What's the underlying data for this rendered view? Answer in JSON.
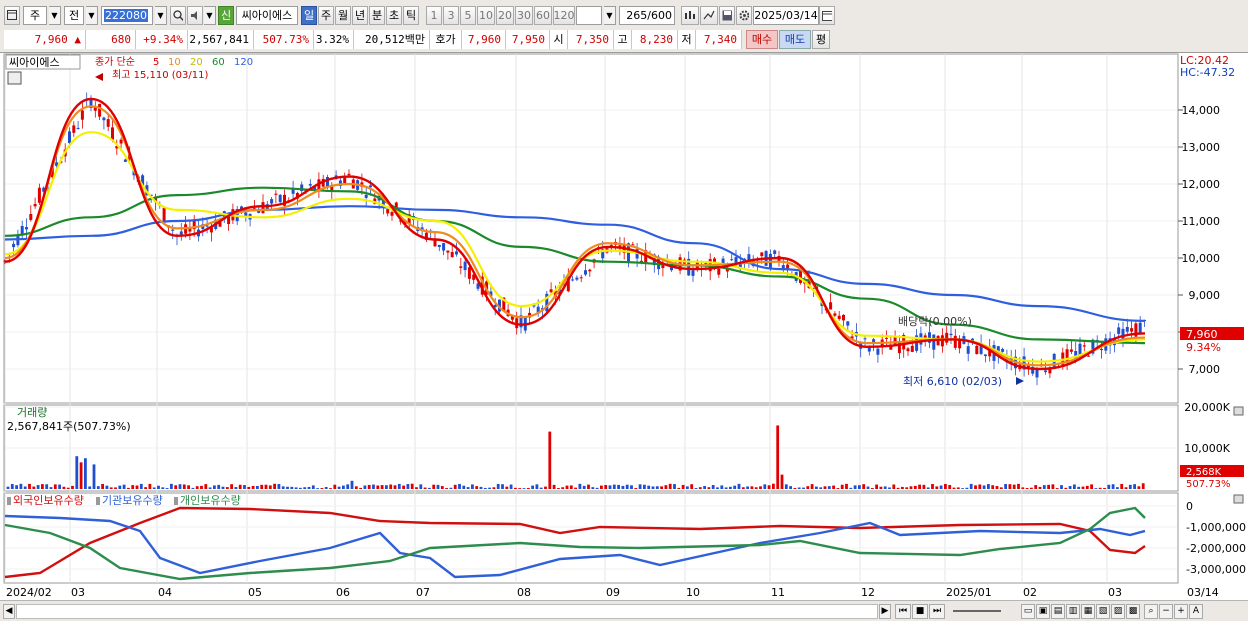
{
  "toolbar": {
    "type_label": "주",
    "prev_label": "전",
    "code": "222080",
    "badge_new": "신",
    "stock_name": "씨아이에스",
    "periods": [
      "일",
      "주",
      "월",
      "년",
      "분",
      "초",
      "틱"
    ],
    "active_period": "일",
    "intervals": [
      "1",
      "3",
      "5",
      "10",
      "20",
      "30",
      "60",
      "120"
    ],
    "count": "265",
    "count_total": "/600",
    "date": "2025/03/14"
  },
  "quote": {
    "price": "7,960",
    "arrow": "▲",
    "change": "680",
    "change_pct": "+9.34%",
    "volume": "2,567,841",
    "volume_pct": "507.73%",
    "turnover_pct": "3.32%",
    "amount": "20,512백만",
    "ask_label": "호가",
    "ask": "7,960",
    "bid": "7,950",
    "open_label": "시",
    "open": "7,350",
    "high_label": "고",
    "high": "8,230",
    "low_label": "저",
    "low": "7,340",
    "buy_label": "매수",
    "sell_label": "매도",
    "avg_label": "평"
  },
  "price_panel": {
    "name": "씨아이에스",
    "ma_label": "종가 단순",
    "ma_periods": [
      "5",
      "10",
      "20",
      "60",
      "120"
    ],
    "high_note": "최고 15,110 (03/11)",
    "low_note": "최저 6,610 (02/03)",
    "dividend_note": "배당락(0.00%)",
    "lc": "LC:20.42",
    "hc": "HC:-47.32",
    "y_ticks": [
      "14,000",
      "13,000",
      "12,000",
      "11,000",
      "10,000",
      "9,000",
      "8,000",
      "7,000"
    ],
    "last_price": "7,960",
    "last_pct": "9.34%"
  },
  "volume_panel": {
    "title": "거래량",
    "value": "2,567,841주(507.73%)",
    "y_ticks": [
      "20,000K",
      "10,000K"
    ],
    "last_value": "2,568K",
    "last_pct": "507.73%"
  },
  "holding_panel": {
    "legend": [
      "외국인보유수량",
      "기관보유수량",
      "개인보유수량"
    ],
    "y_ticks": [
      "0",
      "-1,000,000",
      "-2,000,000",
      "-3,000,000"
    ]
  },
  "x_axis": [
    "2024/02",
    "03",
    "04",
    "05",
    "06",
    "07",
    "08",
    "09",
    "10",
    "11",
    "12",
    "2025/01",
    "02",
    "03",
    "03/14"
  ],
  "colors": {
    "ma5": "#e00000",
    "ma10": "#f08a1c",
    "ma20": "#f4f000",
    "ma60": "#1a8a2a",
    "ma120": "#2f5fe0",
    "up": "#e00000",
    "down": "#1f4fd0",
    "foreign": "#d01010",
    "institution": "#3060d8",
    "individual": "#2d8c4e"
  },
  "chart_data": {
    "type": "line",
    "title": "씨아이에스",
    "x": [
      "2024/02",
      "03",
      "04",
      "05",
      "06",
      "07",
      "08",
      "09",
      "10",
      "11",
      "12",
      "2025/01",
      "02",
      "03"
    ],
    "series": [
      {
        "name": "5",
        "values": [
          9900,
          14300,
          10600,
          11400,
          12200,
          10500,
          8200,
          10300,
          9700,
          10000,
          7600,
          7800,
          7000,
          7960
        ]
      },
      {
        "name": "10",
        "values": [
          10000,
          14100,
          10800,
          11300,
          12000,
          10700,
          8400,
          10400,
          9800,
          9900,
          7700,
          7800,
          7100,
          7850
        ]
      },
      {
        "name": "20",
        "values": [
          10100,
          13400,
          11300,
          11100,
          11600,
          11000,
          8700,
          10200,
          9900,
          9600,
          7900,
          7800,
          7200,
          7800
        ]
      },
      {
        "name": "60",
        "values": [
          10600,
          11100,
          11700,
          11900,
          11800,
          11000,
          10300,
          9900,
          9800,
          9500,
          8900,
          8200,
          7800,
          7700
        ]
      },
      {
        "name": "120",
        "values": [
          10500,
          10600,
          11000,
          11300,
          11400,
          11300,
          11100,
          10900,
          10400,
          9700,
          9300,
          9000,
          8700,
          8300
        ]
      }
    ],
    "ylim": [
      6500,
      15500
    ]
  }
}
